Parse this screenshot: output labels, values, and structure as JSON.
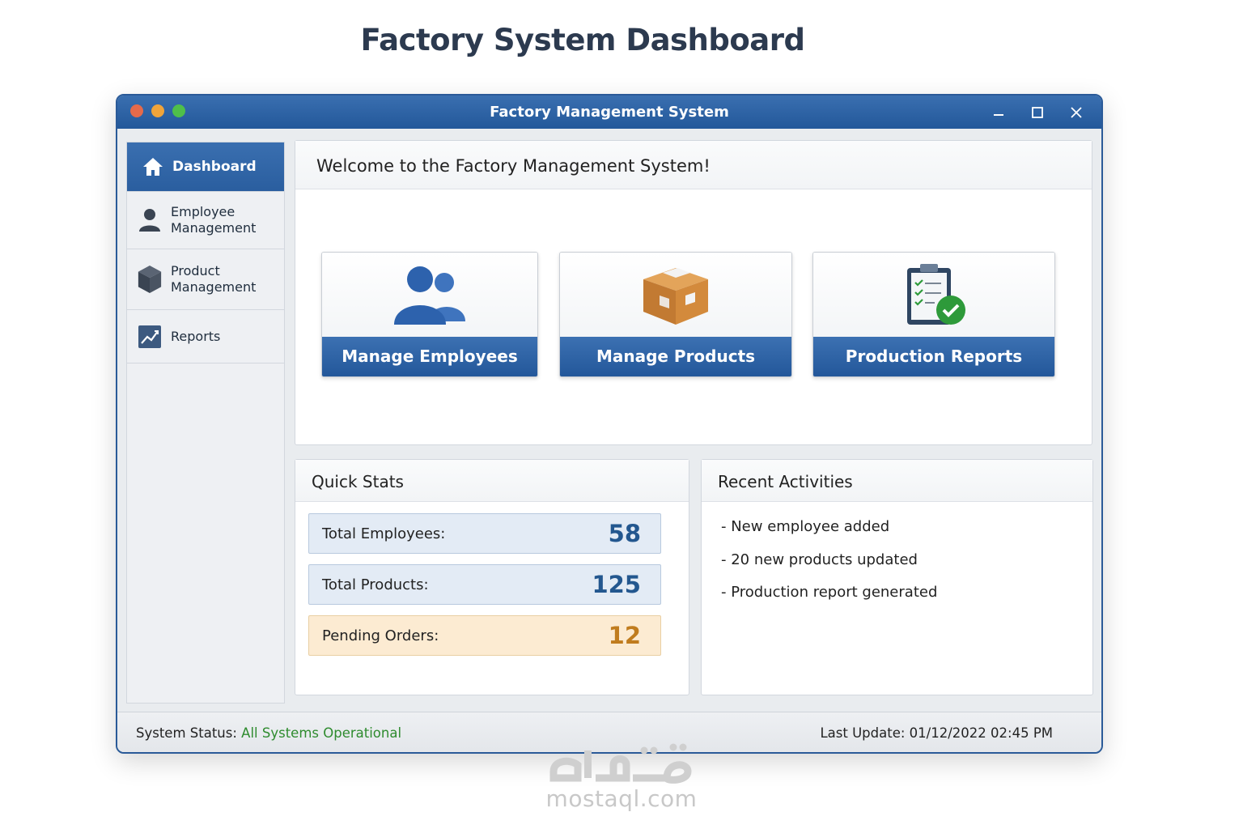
{
  "page_title": "Factory System Dashboard",
  "window": {
    "title": "Factory Management System",
    "controls": {
      "minimize": "minimize-icon",
      "maximize": "maximize-icon",
      "close": "close-icon"
    }
  },
  "sidebar": {
    "items": [
      {
        "label": "Dashboard",
        "icon": "home-icon",
        "active": true
      },
      {
        "label_line1": "Employee",
        "label_line2": "Management",
        "icon": "user-icon"
      },
      {
        "label_line1": "Product",
        "label_line2": "Management",
        "icon": "cube-icon"
      },
      {
        "label": "Reports",
        "icon": "chart-icon"
      }
    ]
  },
  "welcome": {
    "title": "Welcome to the Factory Management System!"
  },
  "cards": [
    {
      "label": "Manage Employees",
      "icon": "users-icon"
    },
    {
      "label": "Manage Products",
      "icon": "box-icon"
    },
    {
      "label": "Production Reports",
      "icon": "clipboard-check-icon"
    }
  ],
  "quick_stats": {
    "title": "Quick Stats",
    "items": [
      {
        "label": "Total Employees:",
        "value": "58"
      },
      {
        "label": "Total Products:",
        "value": "125"
      },
      {
        "label": "Pending Orders:",
        "value": "12"
      }
    ]
  },
  "recent_activities": {
    "title": "Recent Activities",
    "items": [
      "- New employee added",
      "- 20 new products updated",
      "- Production report generated"
    ]
  },
  "status_bar": {
    "status_label": "System Status:",
    "status_value": "All Systems Operational",
    "last_update_label": "Last Update:",
    "last_update_value": "01/12/2022 02:45 PM"
  },
  "watermark": {
    "text": "mostaql.com"
  },
  "colors": {
    "primary": "#2a5e9f",
    "status_ok": "#2e8b2e",
    "pending": "#c07c1e",
    "stat_value": "#23578f"
  }
}
